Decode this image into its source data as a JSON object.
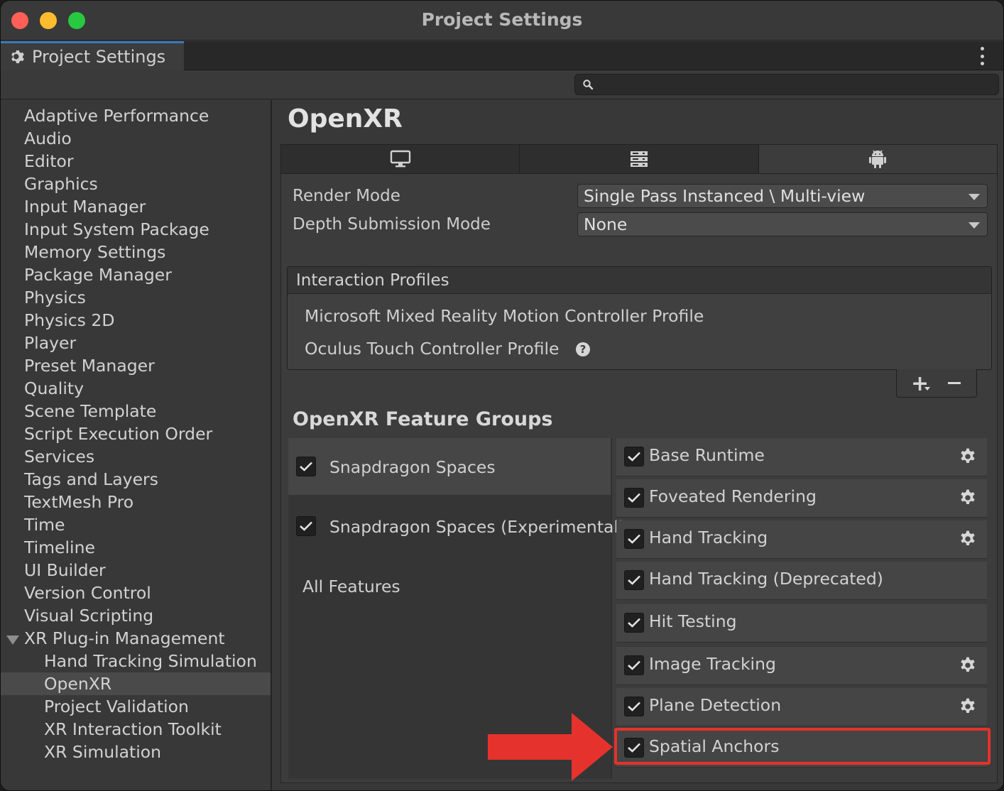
{
  "window": {
    "title": "Project Settings"
  },
  "tab": {
    "label": "Project Settings"
  },
  "search": {
    "placeholder": "",
    "value": ""
  },
  "sidebar": {
    "items": [
      "Adaptive Performance",
      "Audio",
      "Editor",
      "Graphics",
      "Input Manager",
      "Input System Package",
      "Memory Settings",
      "Package Manager",
      "Physics",
      "Physics 2D",
      "Player",
      "Preset Manager",
      "Quality",
      "Scene Template",
      "Script Execution Order",
      "Services",
      "Tags and Layers",
      "TextMesh Pro",
      "Time",
      "Timeline",
      "UI Builder",
      "Version Control",
      "Visual Scripting",
      "XR Plug-in Management"
    ],
    "sub_items": [
      "Hand Tracking Simulation",
      "OpenXR",
      "Project Validation",
      "XR Interaction Toolkit",
      "XR Simulation"
    ],
    "selected": "OpenXR"
  },
  "main": {
    "title": "OpenXR",
    "platform_tabs": [
      "desktop-icon",
      "server-icon",
      "android-icon"
    ],
    "render_mode": {
      "label": "Render Mode",
      "value": "Single Pass Instanced \\ Multi-view"
    },
    "depth_mode": {
      "label": "Depth Submission Mode",
      "value": "None"
    },
    "profiles": {
      "header": "Interaction Profiles",
      "items": [
        "Microsoft Mixed Reality Motion Controller Profile",
        "Oculus Touch Controller Profile"
      ]
    },
    "feature_groups": {
      "title": "OpenXR Feature Groups",
      "groups": [
        "Snapdragon Spaces",
        "Snapdragon Spaces (Experimental)",
        "All Features"
      ],
      "features": [
        "Base Runtime",
        "Foveated Rendering",
        "Hand Tracking",
        "Hand Tracking (Deprecated)",
        "Hit Testing",
        "Image Tracking",
        "Plane Detection",
        "Spatial Anchors"
      ]
    }
  },
  "colors": {
    "accent": "#3a79bb",
    "highlight": "#e5322d"
  }
}
